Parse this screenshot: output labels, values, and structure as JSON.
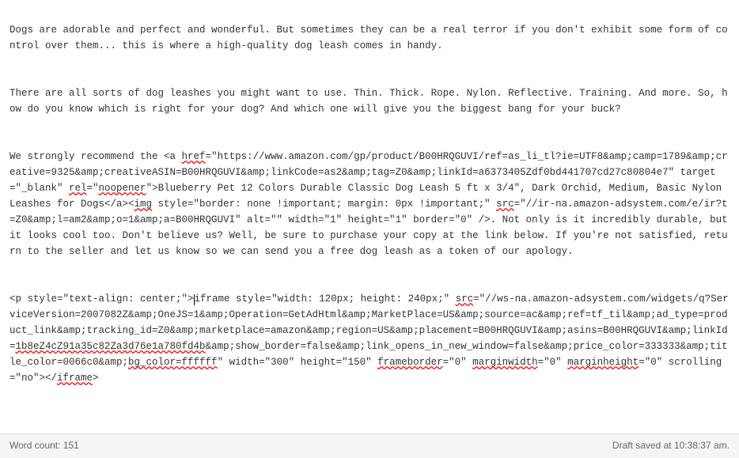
{
  "editor": {
    "p1": "Dogs are adorable and perfect and wonderful. But sometimes they can be a real terror if you don't exhibit some form of control over them... this is where a high-quality dog leash comes in handy.",
    "p2": "There are all sorts of dog leashes you might want to use. Thin. Thick. Rope. Nylon. Reflective. Training. And more. So, how do you know which is right for your dog? And which one will give you the biggest bang for your buck?",
    "p3_a": "We strongly recommend the <a ",
    "p3_href": "href",
    "p3_b": "=\"https://www.amazon.com/gp/product/B00HRQGUVI/ref=as_li_tl?ie=UTF8&amp;camp=1789&amp;creative=9325&amp;creativeASIN=B00HRQGUVI&amp;linkCode=as2&amp;tag=Z0&amp;linkId=a6373405Zdf0bd441707cd27c80804e7\" target=\"_blank\" ",
    "p3_rel": "rel",
    "p3_c": "=\"",
    "p3_noopener": "noopener",
    "p3_d": "\">Blueberry Pet 12 Colors Durable Classic Dog Leash 5 ft x 3/4\", Dark Orchid, Medium, Basic Nylon Leashes for Dogs</a><",
    "p3_img": "img",
    "p3_e": " style=\"border: none !important; margin: 0px !important;\" ",
    "p3_src": "src",
    "p3_f": "=\"//ir-na.amazon-adsystem.com/e/ir?t=Z0&amp;l=am2&amp;o=1&amp;a=B00HRQGUVI\" alt=\"\" width=\"1\" height=\"1\" border=\"0\" />. Not only is it incredibly durable, but it looks cool too. Don't believe us? Well, be sure to purchase your copy at the link below. If you're not satisfied, return to the seller and let us know so we can send you a free dog leash as a token of our apology.",
    "p4_a": "<p style=\"text-align: center;\">",
    "p4_b": "iframe style=\"width: 120px; height: 240px;\" ",
    "p4_src": "src",
    "p4_c": "=\"//ws-na.amazon-adsystem.com/widgets/q?ServiceVersion=2007082Z&amp;OneJS=1&amp;Operation=GetAdHtml&amp;MarketPlace=US&amp;source=ac&amp;ref=tf_til&amp;ad_type=product_link&amp;tracking_id=Z0&amp;marketplace=amazon&amp;region=US&amp;placement=B00HRQGUVI&amp;asins=B00HRQGUVI&amp;linkId=",
    "p4_link": "1b8eZ4cZ91a35c82Za3d76e1a780fd4b",
    "p4_d": "&amp;show_border=false&amp;link_opens_in_new_window=false&amp;price_color=333333&amp;title_color=0066c0&amp;",
    "p4_bg": "bg_color=ffffff",
    "p4_e": "\" width=\"300\" height=\"150\" ",
    "p4_fb": "frameborder",
    "p4_f": "=\"0\" ",
    "p4_mw": "marginwidth",
    "p4_g": "=\"0\" ",
    "p4_mh": "marginheight",
    "p4_h": "=\"0\" scrolling=\"no\"></",
    "p4_iframe": "iframe",
    "p4_i": ">"
  },
  "status": {
    "wordcount_label": "Word count: ",
    "wordcount_value": "151",
    "draft_saved": "Draft saved at 10:38:37 am."
  }
}
